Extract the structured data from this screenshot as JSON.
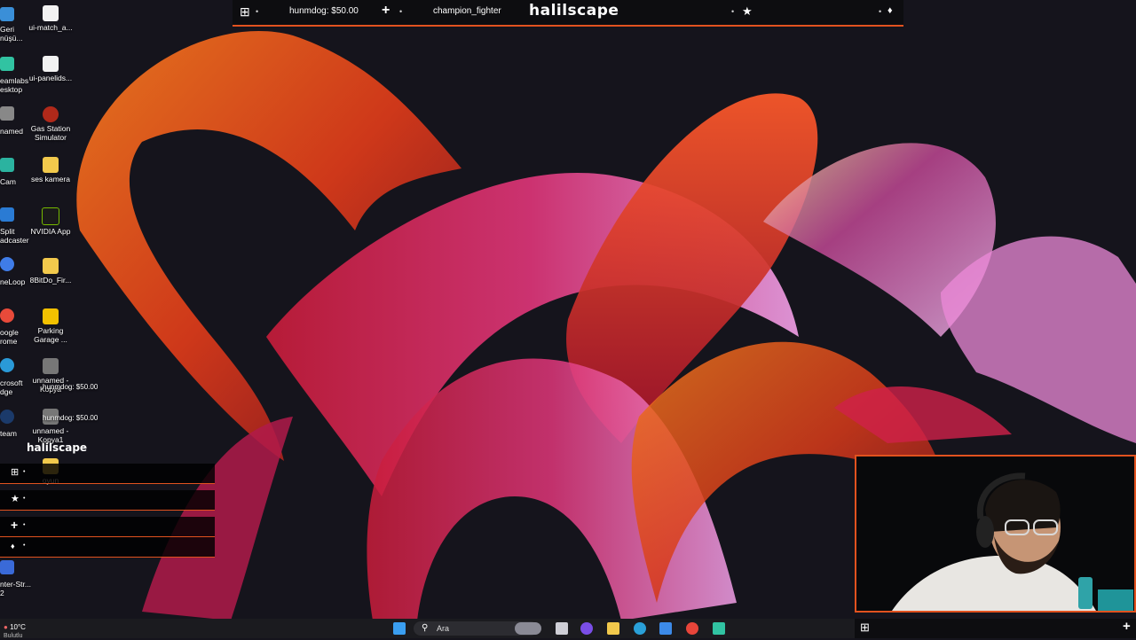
{
  "overlay": {
    "brand": "halilscape",
    "donation": "hunmdog: $50.00",
    "follower": "champion_fighter",
    "icons": [
      "menu-icon",
      "plus-icon",
      "star-icon",
      "drop-icon"
    ],
    "accent": "#e2521f"
  },
  "desktop_icons": [
    {
      "label": "Geri\nnüşü...",
      "partial": true
    },
    {
      "label": "ui-match_a..."
    },
    {
      "label": "eamlabs\nesktop",
      "partial": true
    },
    {
      "label": "ui-panelids..."
    },
    {
      "label": "named",
      "partial": true
    },
    {
      "label": "Gas Station\nSimulator"
    },
    {
      "label": "Cam",
      "partial": true
    },
    {
      "label": "ses kamera"
    },
    {
      "label": "Split\nadcaster",
      "partial": true
    },
    {
      "label": "NVIDIA App"
    },
    {
      "label": "neLoop",
      "partial": true
    },
    {
      "label": "8BitDo_Fir..."
    },
    {
      "label": "oogle\nrome",
      "partial": true
    },
    {
      "label": "Parking\nGarage ..."
    },
    {
      "label": "crosoft\ndge",
      "partial": true
    },
    {
      "label": "unnamed -\nKopya"
    },
    {
      "label": "team",
      "partial": true
    },
    {
      "label": "unnamed -\nKopya1"
    },
    {
      "label": "oyun"
    },
    {
      "label": "nter-Str...\n2",
      "partial": true
    }
  ],
  "mini_overlay": {
    "brand": "halilscape",
    "donation_1": "hunmdog: $50.00",
    "donation_2": "hunmdog: $50.00"
  },
  "taskbar": {
    "weather_temp": "10°C",
    "weather_desc": "Bulutlu",
    "search_placeholder": "Ara",
    "apps": [
      "windows-icon",
      "search-icon",
      "widgets-icon",
      "task-view-icon",
      "copilot-icon",
      "file-explorer-icon",
      "edge-icon",
      "store-icon",
      "chrome-icon",
      "streamlabs-icon"
    ]
  }
}
